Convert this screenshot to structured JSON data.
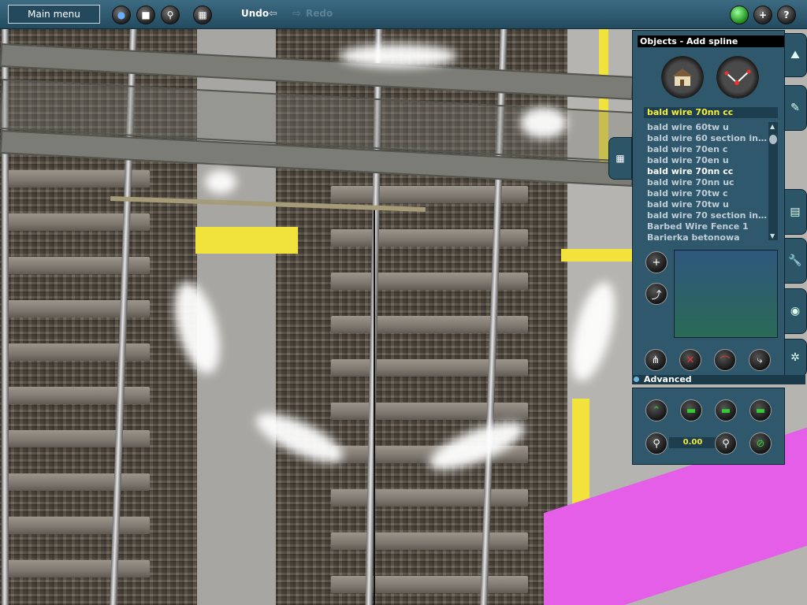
{
  "toolbar": {
    "main_menu": "Main menu",
    "undo": "Undo",
    "redo": "Redo",
    "icons": [
      "globe-icon",
      "stop-icon",
      "magic-wand-icon",
      "grid-icon",
      "status-light-icon",
      "add-icon",
      "help-icon"
    ]
  },
  "panel": {
    "title": "Objects - Add spline",
    "selected": "bald wire 70nn cc",
    "items": [
      "bald wire 60tw u",
      "bald wire 60 section insul...",
      "bald wire 70en c",
      "bald wire 70en u",
      "bald wire 70nn cc",
      "bald wire 70nn uc",
      "bald wire 70tw c",
      "bald wire 70tw u",
      "bald wire 70 section insul...",
      "Barbed Wire Fence 1",
      "Barierka betonowa"
    ],
    "selected_index": 4
  },
  "advanced": {
    "label": "Advanced",
    "value": "0.00"
  },
  "colors": {
    "accent": "#30586c",
    "highlight": "#f7ef3c"
  }
}
